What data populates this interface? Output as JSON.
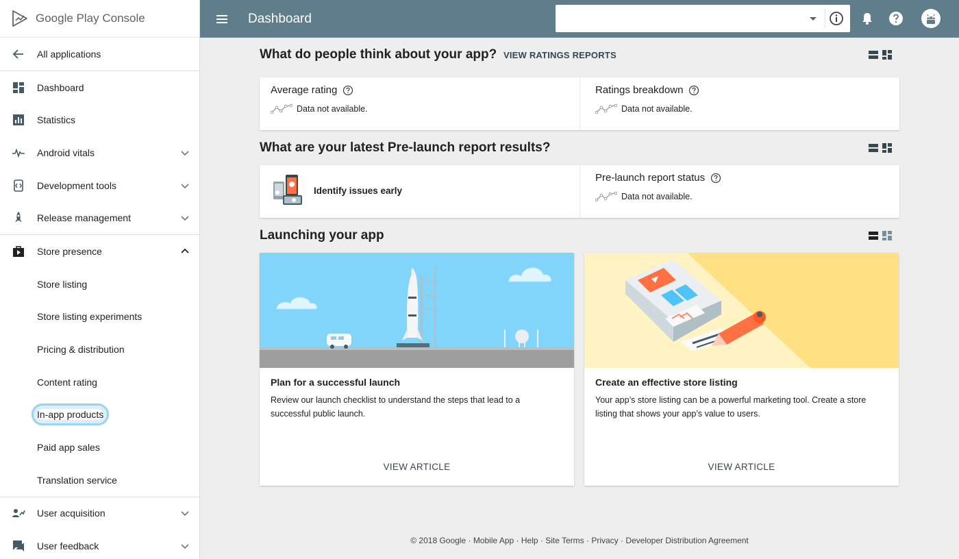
{
  "brand": {
    "logo_text": "Google Play Console"
  },
  "sidebar": {
    "back_label": "All applications",
    "items": [
      {
        "label": "Dashboard",
        "icon": "dashboard-icon"
      },
      {
        "label": "Statistics",
        "icon": "bar-chart-icon"
      },
      {
        "label": "Android vitals",
        "icon": "pulse-icon"
      },
      {
        "label": "Development tools",
        "icon": "code-icon"
      },
      {
        "label": "Release management",
        "icon": "rocket-icon"
      },
      {
        "label": "Store presence",
        "icon": "store-icon"
      }
    ],
    "store_subitems": [
      "Store listing",
      "Store listing experiments",
      "Pricing & distribution",
      "Content rating",
      "In-app products",
      "Paid app sales",
      "Translation service"
    ],
    "bottom_items": [
      {
        "label": "User acquisition",
        "icon": "user-acquisition-icon"
      },
      {
        "label": "User feedback",
        "icon": "feedback-icon"
      }
    ]
  },
  "topbar": {
    "title": "Dashboard",
    "app_select_value": ""
  },
  "ratings": {
    "heading": "What do people think about your app?",
    "link": "VIEW RATINGS REPORTS",
    "average_title": "Average rating",
    "breakdown_title": "Ratings breakdown",
    "not_available": "Data not available."
  },
  "prelaunch": {
    "heading": "What are your latest Pre-launch report results?",
    "identify_label": "Identify issues early",
    "status_title": "Pre-launch report status",
    "not_available": "Data not available."
  },
  "launching": {
    "heading": "Launching your app",
    "articles": [
      {
        "title": "Plan for a successful launch",
        "desc": "Review our launch checklist to understand the steps that lead to a successful public launch.",
        "link": "VIEW ARTICLE"
      },
      {
        "title": "Create an effective store listing",
        "desc": "Your app’s store listing can be a powerful marketing tool. Create a store listing that shows your app’s value to users.",
        "link": "VIEW ARTICLE"
      }
    ]
  },
  "footer": {
    "text": "© 2018 Google · Mobile App · Help · Site Terms · Privacy · Developer Distribution Agreement"
  },
  "colors": {
    "topbar": "#607d8b",
    "sidebar_icon": "#455a64",
    "highlight_ring": "#9ad2f0"
  }
}
